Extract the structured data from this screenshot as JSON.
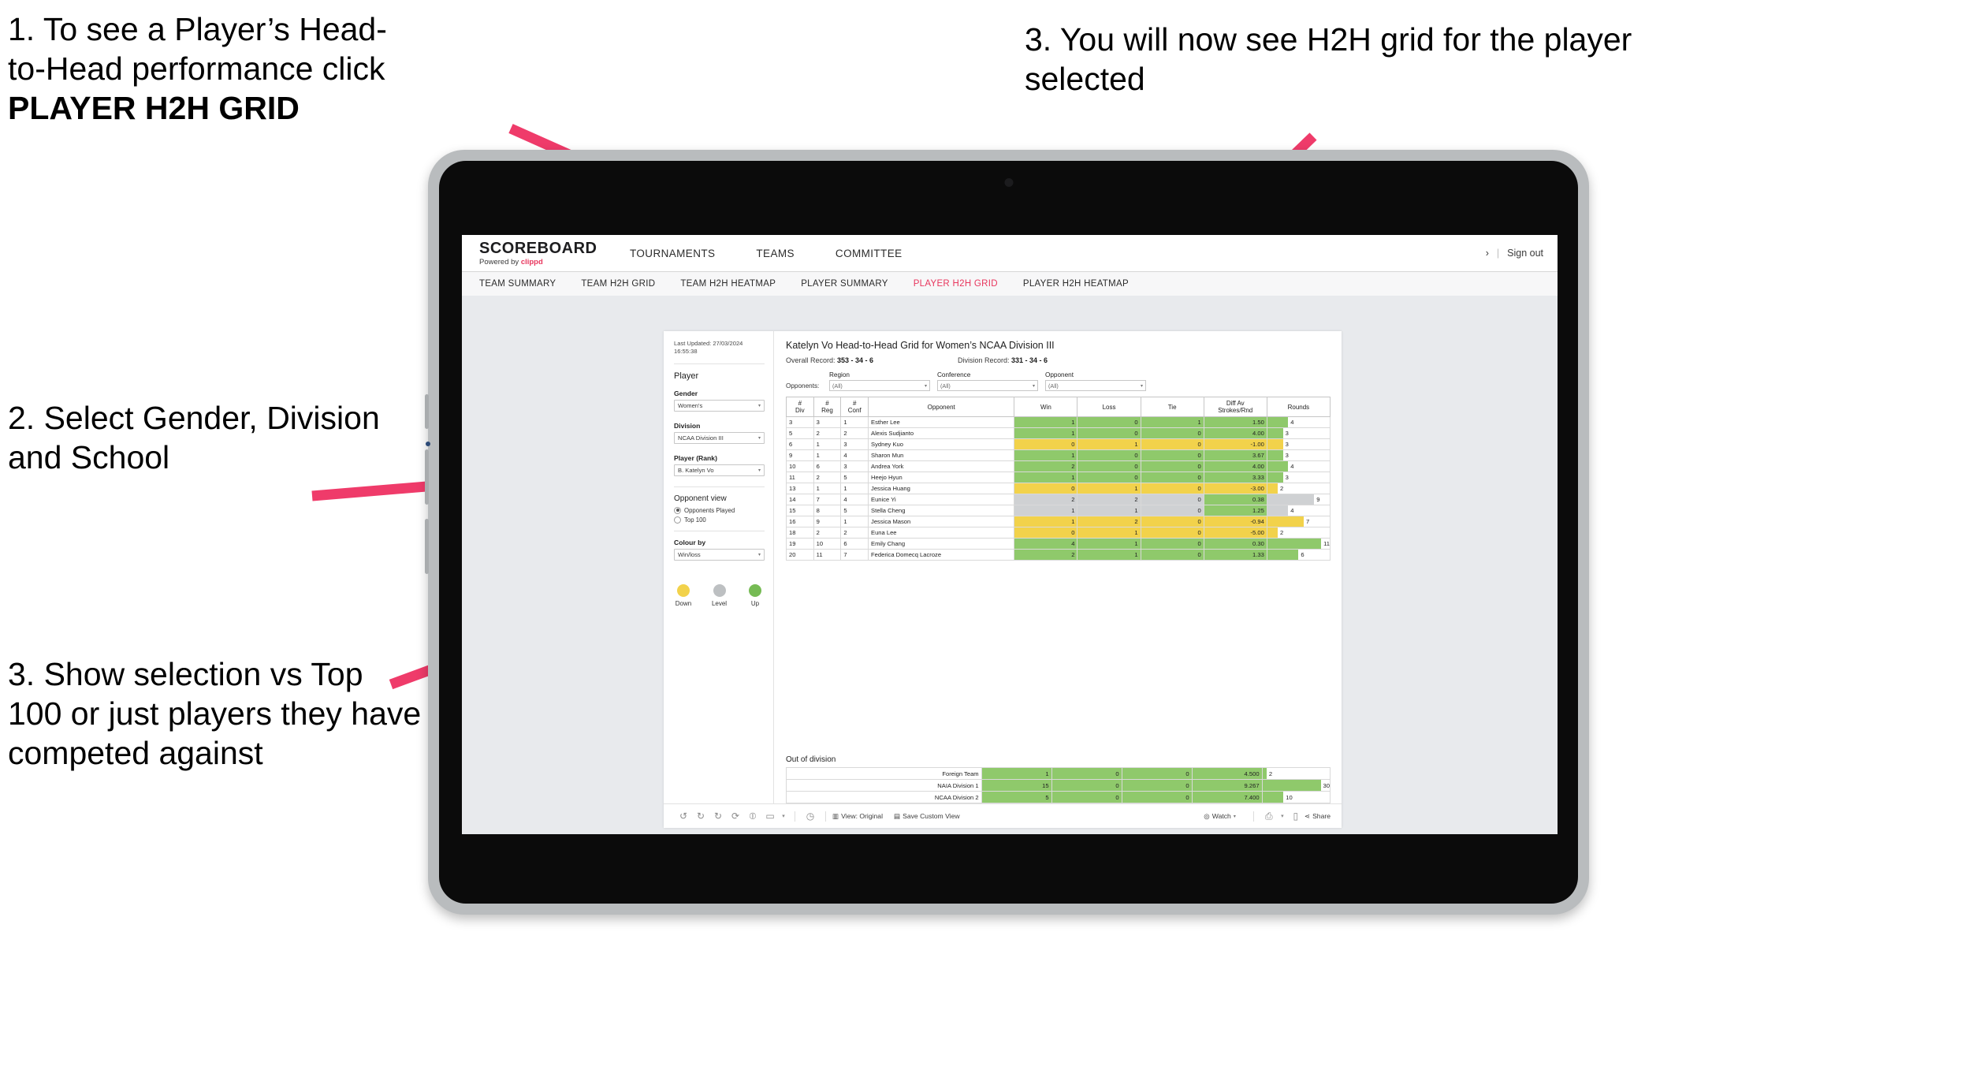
{
  "annotations": {
    "step1_line1": "1. To see a Player’s Head-",
    "step1_line2": "to-Head performance click",
    "step1_bold": "PLAYER H2H GRID",
    "step2": "2. Select Gender, Division and School",
    "step3_top": "3. You will now see H2H grid for the player selected",
    "step3_left": "3. Show selection vs Top 100 or just players they have competed against",
    "arrow_color": "#ef3b6a"
  },
  "app": {
    "logo_main": "SCOREBOARD",
    "logo_sub_prefix": "Powered by ",
    "logo_sub_brand": "clippd",
    "header_menu": [
      "TOURNAMENTS",
      "TEAMS",
      "COMMITTEE"
    ],
    "header_right": {
      "chevron": "›",
      "separator": "|",
      "sign_out": "Sign out"
    },
    "sub_nav": [
      {
        "label": "TEAM SUMMARY",
        "active": false
      },
      {
        "label": "TEAM H2H GRID",
        "active": false
      },
      {
        "label": "TEAM H2H HEATMAP",
        "active": false
      },
      {
        "label": "PLAYER SUMMARY",
        "active": false
      },
      {
        "label": "PLAYER H2H GRID",
        "active": true
      },
      {
        "label": "PLAYER H2H HEATMAP",
        "active": false
      }
    ],
    "accent_color": "#e8365d"
  },
  "filters": {
    "last_updated": "Last Updated: 27/03/2024 16:55:38",
    "player_title": "Player",
    "gender": {
      "label": "Gender",
      "value": "Women's"
    },
    "division": {
      "label": "Division",
      "value": "NCAA Division III"
    },
    "player_rank": {
      "label": "Player (Rank)",
      "value": "B. Katelyn Vo"
    },
    "opponent_view": {
      "title": "Opponent view",
      "options": [
        {
          "label": "Opponents Played",
          "selected": true
        },
        {
          "label": "Top 100",
          "selected": false
        }
      ]
    },
    "colour_by": {
      "label": "Colour by",
      "value": "Win/loss"
    },
    "legend": [
      {
        "label": "Down",
        "color": "#f2d24b"
      },
      {
        "label": "Level",
        "color": "#bdc0c2"
      },
      {
        "label": "Up",
        "color": "#76bb54"
      }
    ]
  },
  "viz": {
    "title": "Katelyn Vo Head-to-Head Grid for Women’s NCAA Division III",
    "overall_record_label": "Overall Record: ",
    "overall_record_value": "353 -  34 - 6",
    "division_record_label": "Division Record: ",
    "division_record_value": "331 -  34 - 6",
    "opponents_label": "Opponents:",
    "opponent_filters": [
      {
        "head": "Region",
        "value": "(All)"
      },
      {
        "head": "Conference",
        "value": "(All)"
      },
      {
        "head": "Opponent",
        "value": "(All)"
      }
    ],
    "out_of_division_title": "Out of division"
  },
  "chart_data": {
    "type": "table",
    "title": "Katelyn Vo Head-to-Head Grid for Women’s NCAA Division III",
    "columns": [
      "# Div",
      "# Reg",
      "# Conf",
      "Opponent",
      "Win",
      "Loss",
      "Tie",
      "Diff Av Strokes/Rnd",
      "Rounds"
    ],
    "column_lines": [
      [
        "#",
        "Div"
      ],
      [
        "#",
        "Reg"
      ],
      [
        "#",
        "Conf"
      ],
      [
        "Opponent"
      ],
      [
        "Win"
      ],
      [
        "Loss"
      ],
      [
        "Tie"
      ],
      [
        "Diff Av",
        "Strokes/Rnd"
      ],
      [
        "Rounds"
      ]
    ],
    "rounds_max": 12,
    "rows": [
      {
        "div": "3",
        "reg": "3",
        "conf": "1",
        "opponent": "Esther Lee",
        "win": "1",
        "loss": "0",
        "tie": "1",
        "diff": "1.50",
        "rounds": 4,
        "color": "#8fc96b"
      },
      {
        "div": "5",
        "reg": "2",
        "conf": "2",
        "opponent": "Alexis Sudjianto",
        "win": "1",
        "loss": "0",
        "tie": "0",
        "diff": "4.00",
        "rounds": 3,
        "color": "#8fc96b"
      },
      {
        "div": "6",
        "reg": "1",
        "conf": "3",
        "opponent": "Sydney Kuo",
        "win": "0",
        "loss": "1",
        "tie": "0",
        "diff": "-1.00",
        "rounds": 3,
        "color": "#f2d24b"
      },
      {
        "div": "9",
        "reg": "1",
        "conf": "4",
        "opponent": "Sharon Mun",
        "win": "1",
        "loss": "0",
        "tie": "0",
        "diff": "3.67",
        "rounds": 3,
        "color": "#8fc96b"
      },
      {
        "div": "10",
        "reg": "6",
        "conf": "3",
        "opponent": "Andrea York",
        "win": "2",
        "loss": "0",
        "tie": "0",
        "diff": "4.00",
        "rounds": 4,
        "color": "#8fc96b"
      },
      {
        "div": "11",
        "reg": "2",
        "conf": "5",
        "opponent": "Heejo Hyun",
        "win": "1",
        "loss": "0",
        "tie": "0",
        "diff": "3.33",
        "rounds": 3,
        "color": "#8fc96b"
      },
      {
        "div": "13",
        "reg": "1",
        "conf": "1",
        "opponent": "Jessica Huang",
        "win": "0",
        "loss": "1",
        "tie": "0",
        "diff": "-3.00",
        "rounds": 2,
        "color": "#f2d24b"
      },
      {
        "div": "14",
        "reg": "7",
        "conf": "4",
        "opponent": "Eunice Yi",
        "win": "2",
        "loss": "2",
        "tie": "0",
        "diff": "0.38",
        "rounds": 9,
        "color": "#cfd1d3",
        "diff_color": "#8fc96b"
      },
      {
        "div": "15",
        "reg": "8",
        "conf": "5",
        "opponent": "Stella Cheng",
        "win": "1",
        "loss": "1",
        "tie": "0",
        "diff": "1.25",
        "rounds": 4,
        "color": "#cfd1d3",
        "diff_color": "#8fc96b"
      },
      {
        "div": "16",
        "reg": "9",
        "conf": "1",
        "opponent": "Jessica Mason",
        "win": "1",
        "loss": "2",
        "tie": "0",
        "diff": "-0.94",
        "rounds": 7,
        "color": "#f2d24b"
      },
      {
        "div": "18",
        "reg": "2",
        "conf": "2",
        "opponent": "Euna Lee",
        "win": "0",
        "loss": "1",
        "tie": "0",
        "diff": "-5.00",
        "rounds": 2,
        "color": "#f2d24b"
      },
      {
        "div": "19",
        "reg": "10",
        "conf": "6",
        "opponent": "Emily Chang",
        "win": "4",
        "loss": "1",
        "tie": "0",
        "diff": "0.30",
        "rounds": 11,
        "color": "#8fc96b"
      },
      {
        "div": "20",
        "reg": "11",
        "conf": "7",
        "opponent": "Federica Domecq Lacroze",
        "win": "2",
        "loss": "1",
        "tie": "0",
        "diff": "1.33",
        "rounds": 6,
        "color": "#8fc96b"
      }
    ],
    "out_of_division": {
      "rounds_max": 32,
      "rows": [
        {
          "label": "Foreign Team",
          "win": "1",
          "loss": "0",
          "tie": "0",
          "diff": "4.500",
          "rounds": 2,
          "color": "#8fc96b"
        },
        {
          "label": "NAIA Division 1",
          "win": "15",
          "loss": "0",
          "tie": "0",
          "diff": "9.267",
          "rounds": 30,
          "color": "#8fc96b"
        },
        {
          "label": "NCAA Division 2",
          "win": "5",
          "loss": "0",
          "tie": "0",
          "diff": "7.400",
          "rounds": 10,
          "color": "#8fc96b"
        }
      ]
    }
  },
  "toolbar": {
    "icons": [
      "undo-icon",
      "redo-icon",
      "revert-icon",
      "refresh-icon",
      "pause-icon",
      "reset-icon"
    ],
    "view_original": "View: Original",
    "save_custom_view": "Save Custom View",
    "watch": "Watch",
    "share": "Share"
  }
}
